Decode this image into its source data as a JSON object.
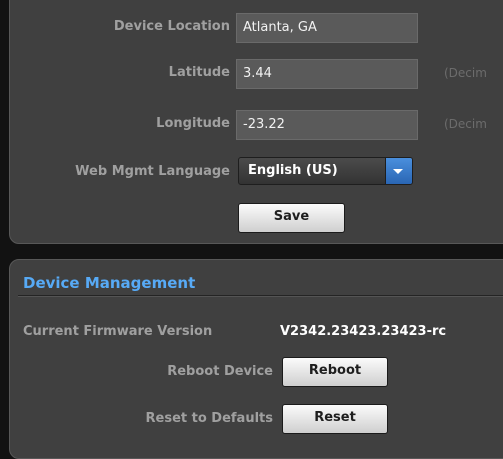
{
  "settings": {
    "device_location": {
      "label": "Device Location",
      "value": "Atlanta, GA"
    },
    "latitude": {
      "label": "Latitude",
      "value": "3.44",
      "hint": "(Decim"
    },
    "longitude": {
      "label": "Longitude",
      "value": "-23.22",
      "hint": "(Decim"
    },
    "language": {
      "label": "Web Mgmt Language",
      "selected": "English (US)"
    },
    "save_label": "Save"
  },
  "device_management": {
    "title": "Device Management",
    "firmware": {
      "label": "Current Firmware Version",
      "value": "V2342.23423.23423-rc"
    },
    "reboot": {
      "label": "Reboot Device",
      "button": "Reboot"
    },
    "reset": {
      "label": "Reset to Defaults",
      "button": "Reset"
    }
  },
  "colors": {
    "background": "#121212",
    "panel": "#404040",
    "accent": "#57aaf6",
    "label": "#a0a0a0"
  },
  "icons": {
    "select_arrow": "chevron-down-icon"
  }
}
